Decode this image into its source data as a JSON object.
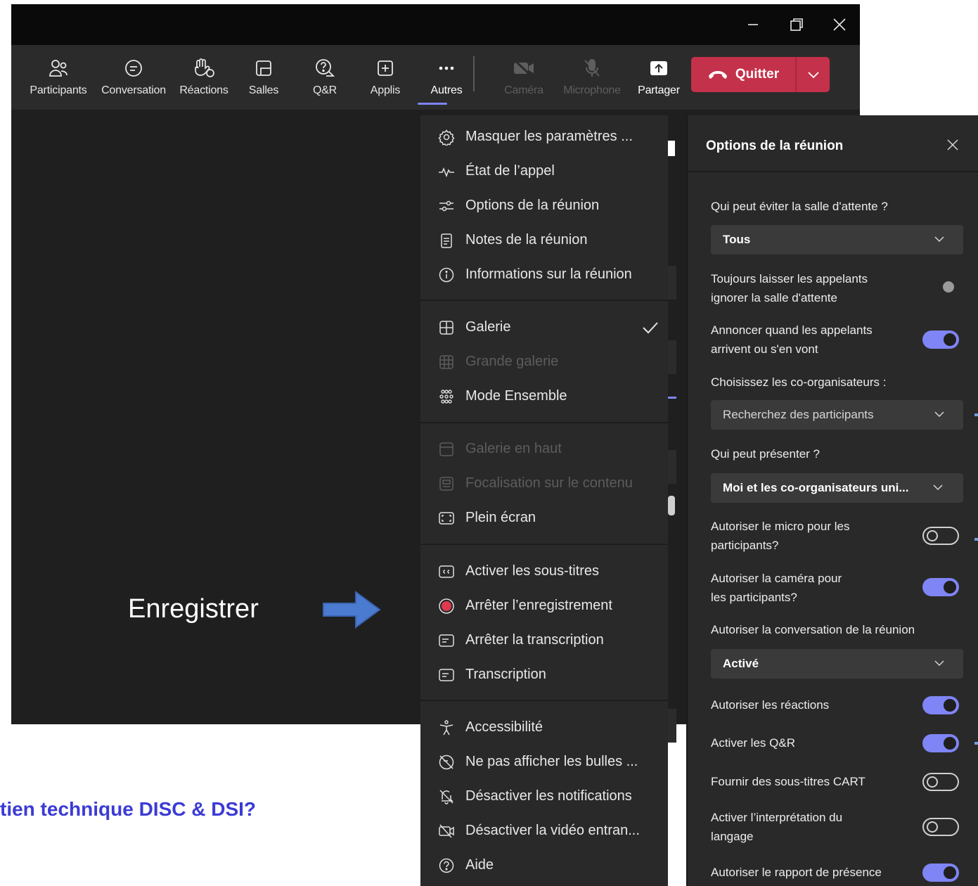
{
  "window": {
    "controls": {
      "minimize_icon": "minimize-icon",
      "restore_icon": "restore-icon",
      "close_icon": "close-icon"
    }
  },
  "toolbar": {
    "participants": "Participants",
    "conversation": "Conversation",
    "reactions": "Réactions",
    "rooms": "Salles",
    "qa": "Q&R",
    "apps": "Applis",
    "more": "Autres",
    "camera": "Caméra",
    "microphone": "Microphone",
    "share": "Partager",
    "quit": "Quitter"
  },
  "annotation": {
    "label": "Enregistrer",
    "bottom_text": "tien technique DISC & DSI?"
  },
  "menu": {
    "items": [
      {
        "label": "Masquer les paramètres ...",
        "icon": "gear-icon"
      },
      {
        "label": "État de l’appel",
        "icon": "pulse-icon"
      },
      {
        "label": "Options de la réunion",
        "icon": "sliders-icon"
      },
      {
        "label": "Notes de la réunion",
        "icon": "notes-icon"
      },
      {
        "label": "Informations sur la réunion",
        "icon": "info-icon"
      },
      {
        "label": "Galerie",
        "icon": "gallery-icon"
      },
      {
        "label": "Grande galerie",
        "icon": "large-gallery-icon"
      },
      {
        "label": "Mode Ensemble",
        "icon": "together-mode-icon"
      },
      {
        "label": "Galerie en haut",
        "icon": "gallery-top-icon"
      },
      {
        "label": "Focalisation sur le contenu",
        "icon": "focus-content-icon"
      },
      {
        "label": "Plein écran",
        "icon": "fullscreen-icon"
      },
      {
        "label": "Activer les sous-titres",
        "icon": "captions-icon"
      },
      {
        "label": "Arrêter l’enregistrement",
        "icon": "record-icon"
      },
      {
        "label": "Arrêter la transcription",
        "icon": "transcript-icon"
      },
      {
        "label": "Transcription",
        "icon": "transcript-icon"
      },
      {
        "label": "Accessibilité",
        "icon": "accessibility-icon"
      },
      {
        "label": "Ne pas afficher les bulles ...",
        "icon": "no-bubbles-icon"
      },
      {
        "label": "Désactiver les notifications",
        "icon": "bell-off-icon"
      },
      {
        "label": "Désactiver la vidéo entran...",
        "icon": "video-off-icon"
      },
      {
        "label": "Aide",
        "icon": "help-icon"
      }
    ]
  },
  "options": {
    "title": "Options de la réunion",
    "lobby_label": "Qui peut éviter la salle d'attente ?",
    "lobby_value": "Tous",
    "callers_line1": "Toujours laisser les appelants",
    "callers_line2": "ignorer la salle d'attente",
    "announce_line1": "Annoncer quand les appelants",
    "announce_line2": "arrivent ou s'en vont",
    "coorg_label": "Choisissez les co-organisateurs :",
    "coorg_placeholder": "Recherchez des participants",
    "present_label": "Qui peut présenter ?",
    "present_value": "Moi et les co-organisateurs uni...",
    "mic_line1": "Autoriser le micro pour les",
    "mic_line2": "participants?",
    "cam_line1": "Autoriser la caméra pour",
    "cam_line2": "les participants?",
    "chat_label": "Autoriser la conversation de la réunion",
    "chat_value": "Activé",
    "reactions_label": "Autoriser les réactions",
    "qa_label": "Activer les Q&R",
    "cart_label": "Fournir des sous-titres CART",
    "interp_line1": "Activer l’interprétation du",
    "interp_line2": "langage",
    "attendance_label": "Autoriser le rapport de présence"
  },
  "colors": {
    "accent": "#7f85f5",
    "quit_red": "#c4314b",
    "annotation_arrow": "#4a7bd0",
    "bottom_text": "#3b3bd6"
  }
}
